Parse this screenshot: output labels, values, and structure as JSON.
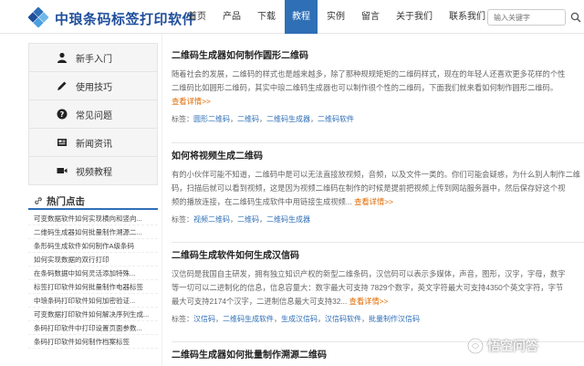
{
  "brand": {
    "name": "中琅条码标签打印软件"
  },
  "nav": {
    "items": [
      "首页",
      "产品",
      "下载",
      "教程",
      "实例",
      "留言",
      "关于我们",
      "联系我们"
    ],
    "active_index": 3
  },
  "search": {
    "placeholder": "输入关键字"
  },
  "left_menu": {
    "items": [
      {
        "label": "新手入门",
        "icon": "user-icon"
      },
      {
        "label": "使用技巧",
        "icon": "pencil-icon"
      },
      {
        "label": "常见问题",
        "icon": "question-icon"
      },
      {
        "label": "新闻资讯",
        "icon": "news-icon"
      },
      {
        "label": "视频教程",
        "icon": "video-icon"
      }
    ]
  },
  "hot": {
    "title": "热门点击",
    "items": [
      "可变数据软件如何实现横向和竖向...",
      "二维码生成器如何批量制作溯源二...",
      "条形码生成软件如何制作A级条码",
      "如何实现数据的双行打印",
      "在条码数据中如何灵活添加特殊...",
      "标签打印软件如何批量制作电器标签",
      "中琅条码打印软件如何加密验证...",
      "可变数据打印软件如何解决序列生成...",
      "条码打印软件中打印设置页面参数...",
      "条码打印软件如何制作档案标签"
    ]
  },
  "articles": [
    {
      "title": "二维码生成器如何制作圆形二维码",
      "lines": [
        "随着社会的发展，二维码的样式也是越来越多，除了那种规规矩矩的二维码样式，现在的年轻人还喜欢更多花样的个性",
        "二维码比如圆形二维码，其实中琅二维码生成器也可以制作很个性的二维码，下面我们就来看如何制作圆形二维码。"
      ],
      "more": "查看详情>>",
      "more_inline": false,
      "tags_label": "标签：",
      "tags": [
        "圆形二维码",
        "二维码",
        "二维码生成器",
        "二维码软件"
      ]
    },
    {
      "title": "如何将视频生成二维码",
      "lines": [
        "有的小伙伴可能不知道，二维码中是可以无法直接放视频，音频，以及文件一类的。你们可能会疑惑，为什么别人制作二维",
        "码，扫描后就可以看到视频，这是因为视频二维码在制作的时候是提前把视频上传到网站服务器中，然后保存好这个视",
        "频的播放连接，在二维码生成软件中用链接生成视频..."
      ],
      "more": "查看详情>>",
      "more_inline": true,
      "tags_label": "标签：",
      "tags": [
        "视频二维码",
        "二维码",
        "二维码生成器"
      ]
    },
    {
      "title": "二维码生成软件如何生成汉信码",
      "lines": [
        "汉信码是我国自主研发，拥有独立知识产权的新型二维条码，汉信码可以表示多媒体，声音，图形，汉字，字母，数字",
        "等一切可以二进制化的信息，信息容量大：数字最大可支持 7829个数字，英文字符最大可支持4350个英文字符，字节",
        "最大可支持2174个汉字，二进制信息最大可支持32..."
      ],
      "more": "查看详情>>",
      "more_inline": true,
      "tags_label": "标签：",
      "tags": [
        "汉信码",
        "二维码生成软件",
        "生成汉信码",
        "汉信码软件",
        "批量制作汉信码"
      ]
    },
    {
      "title": "二维码生成器如何批量制作溯源二维码"
    }
  ],
  "watermark": {
    "text": "悟空问答"
  },
  "colors": {
    "accent": "#2f6fb6",
    "brand": "#1f4e9b",
    "more": "#e06a00"
  }
}
